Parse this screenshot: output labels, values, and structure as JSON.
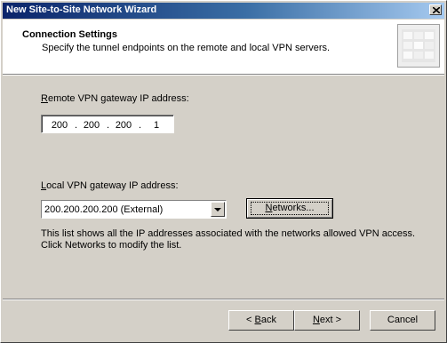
{
  "window": {
    "title": "New Site-to-Site Network Wizard"
  },
  "header": {
    "title": "Connection Settings",
    "subtitle": "Specify the tunnel endpoints on the remote and local VPN servers."
  },
  "remote": {
    "label_hotkey": "R",
    "label_rest": "emote VPN gateway IP address:",
    "octets": [
      "200",
      "200",
      "200",
      "1"
    ],
    "dot": "."
  },
  "local": {
    "label_hotkey": "L",
    "label_rest": "ocal VPN gateway IP address:",
    "selected": "200.200.200.200 (External)",
    "networks_hotkey": "N",
    "networks_rest": "etworks...",
    "info_line1": "This list shows all the IP addresses associated with the networks allowed VPN access.",
    "info_line2": "Click Networks to modify the list."
  },
  "footer": {
    "back_prefix": "< ",
    "back_hotkey": "B",
    "back_rest": "ack",
    "next_hotkey": "N",
    "next_rest": "ext >",
    "cancel": "Cancel"
  }
}
